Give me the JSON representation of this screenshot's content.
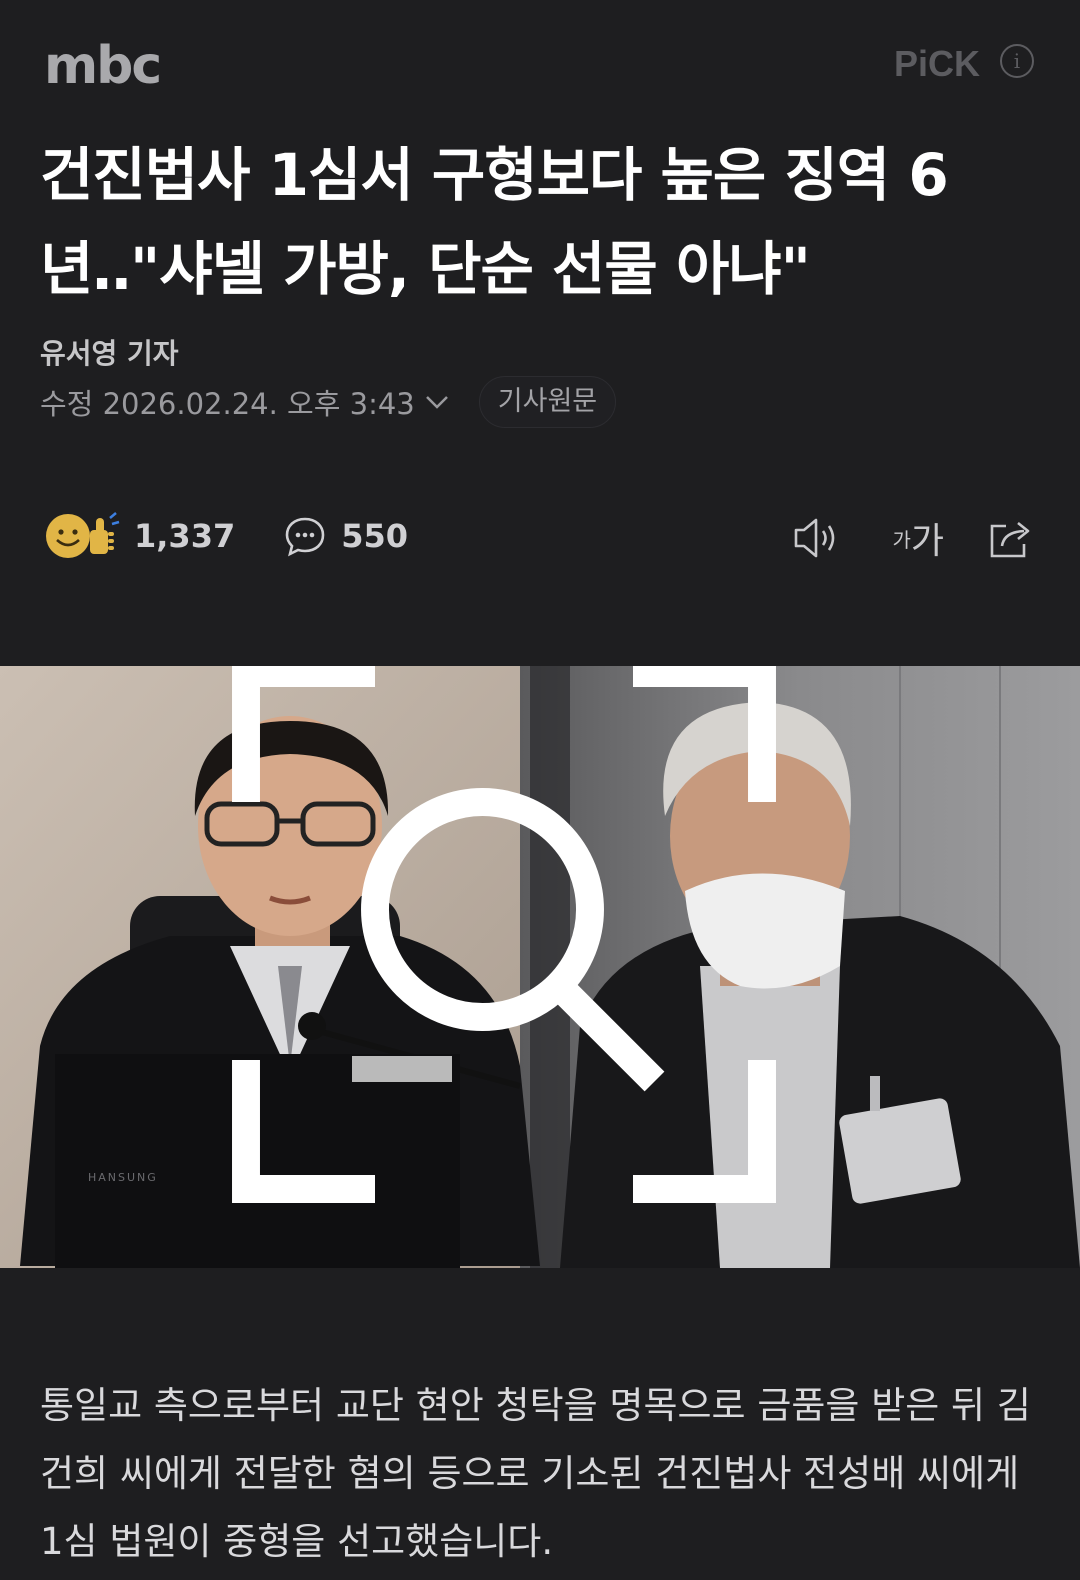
{
  "header": {
    "logo": "mbc",
    "pick_label": "PiCK",
    "pick_info_icon": "i"
  },
  "article": {
    "headline": "건진법사 1심서 구형보다 높은 징역 6년‥\"샤넬 가방, 단순 선물 아냐\"",
    "reporter": "유서영 기자",
    "date_label": "수정 2026.02.24. 오후 3:43",
    "original_button": "기사원문",
    "body": "통일교 측으로부터 교단 현안 청탁을 명목으로 금품을 받은 뒤 김건희 씨에게 전달한 혐의 등으로 기소된 건진법사 전성배 씨에게 1심 법원이 중형을 선고했습니다."
  },
  "reactions": {
    "emoji_icon": "smiley-thumbs-up-icon",
    "count": "1,337",
    "comment_icon": "speech-bubble-icon",
    "comment_count": "550"
  },
  "tools": {
    "audio_icon": "speaker-icon",
    "font_small": "가",
    "font_big": "가",
    "share_icon": "share-icon"
  },
  "photo": {
    "laptop_brand": "HANSUNG",
    "zoom_icon": "zoom-icon"
  },
  "colors": {
    "background": "#1e1e20",
    "headline": "#ffffff",
    "muted": "#9a9a9e"
  }
}
